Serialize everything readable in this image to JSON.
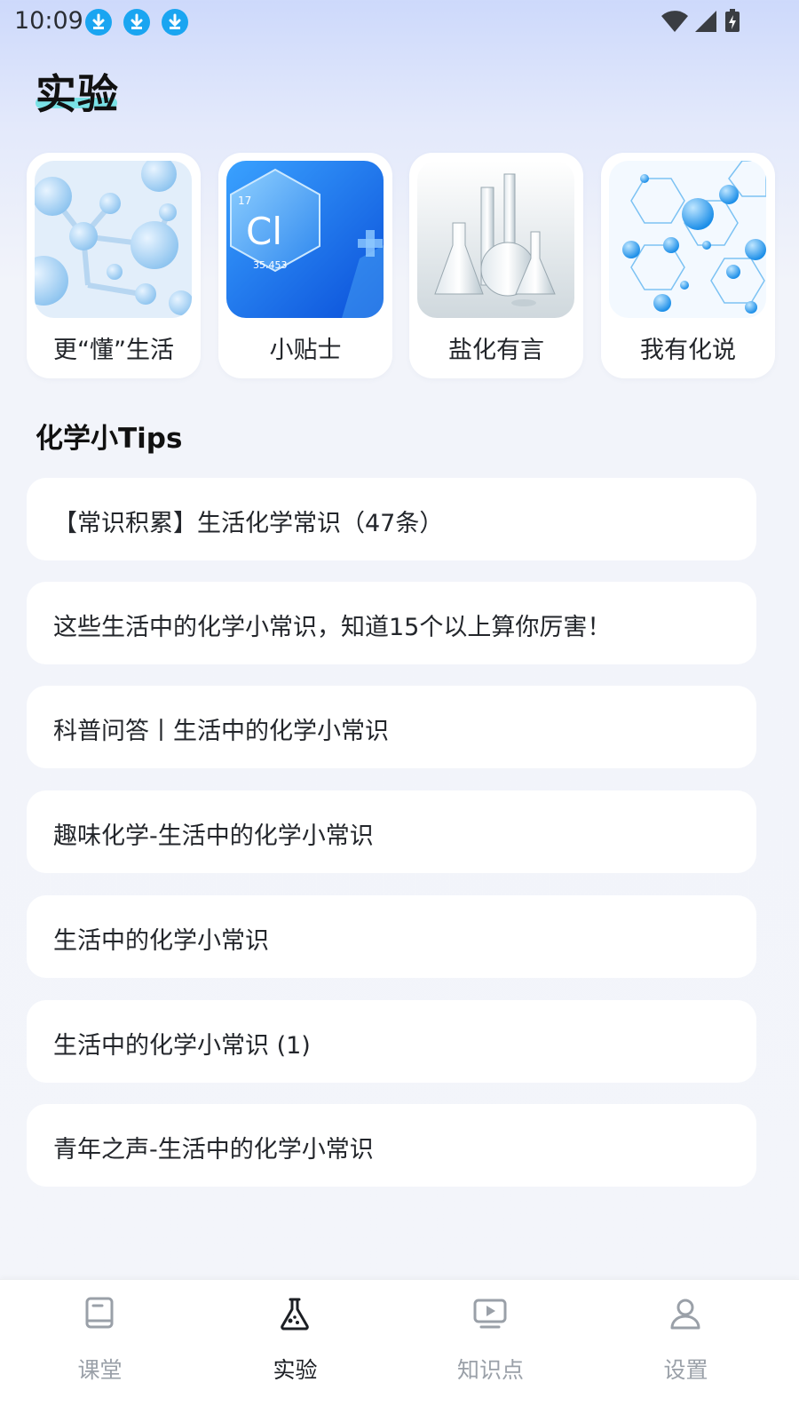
{
  "status_bar": {
    "time": "10:09",
    "notification_icons": [
      "download-icon",
      "download-icon",
      "download-icon"
    ],
    "system_icons": [
      "wifi-icon",
      "signal-icon",
      "battery-charging-icon"
    ]
  },
  "page": {
    "title": "实验",
    "accent_color": "#58e0df"
  },
  "categories": [
    {
      "label": "更“懂”生活",
      "icon": "molecule-image"
    },
    {
      "label": "小贴士",
      "icon": "chlorine-element-image",
      "element_number": "17",
      "element_symbol": "Cl",
      "element_mass": "35.453"
    },
    {
      "label": "盐化有言",
      "icon": "lab-flasks-image"
    },
    {
      "label": "我有化说",
      "icon": "molecular-lattice-image"
    }
  ],
  "tips_section": {
    "title": "化学小Tips",
    "items": [
      "【常识积累】生活化学常识（47条）",
      "这些生活中的化学小常识，知道15个以上算你厉害！",
      "科普问答丨生活中的化学小常识",
      "趣味化学-生活中的化学小常识",
      "生活中的化学小常识",
      "生活中的化学小常识 (1)",
      "青年之声-生活中的化学小常识"
    ]
  },
  "bottom_nav": {
    "active_index": 1,
    "items": [
      {
        "label": "课堂",
        "icon": "book-icon"
      },
      {
        "label": "实验",
        "icon": "flask-icon"
      },
      {
        "label": "知识点",
        "icon": "video-play-icon"
      },
      {
        "label": "设置",
        "icon": "user-icon"
      }
    ]
  }
}
